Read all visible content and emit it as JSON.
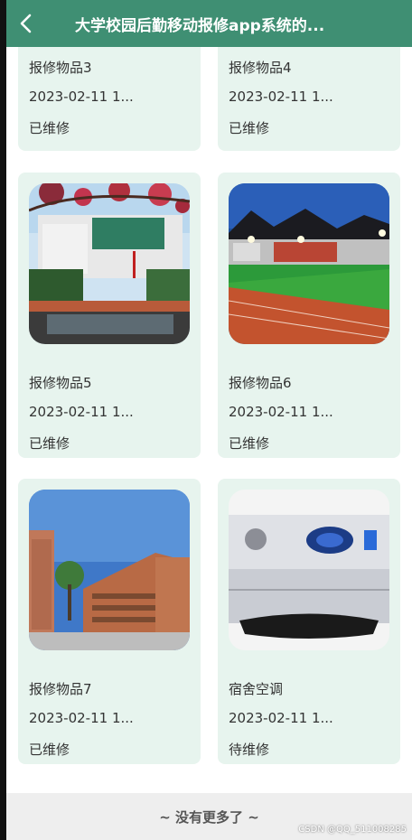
{
  "header": {
    "title": "大学校园后勤移动报修app系统的...",
    "back_icon": "chevron-left-icon",
    "bg_color": "#3f8f73"
  },
  "items": [
    {
      "name": "报修物品3",
      "date": "2023-02-11 1...",
      "status": "已维修"
    },
    {
      "name": "报修物品4",
      "date": "2023-02-11 1...",
      "status": "已维修"
    },
    {
      "name": "报修物品5",
      "date": "2023-02-11 1...",
      "status": "已维修"
    },
    {
      "name": "报修物品6",
      "date": "2023-02-11 1...",
      "status": "已维修"
    },
    {
      "name": "报修物品7",
      "date": "2023-02-11 1...",
      "status": "已维修"
    },
    {
      "name": "宿舍空调",
      "date": "2023-02-11 1...",
      "status": "待维修"
    }
  ],
  "footer": {
    "text": "~ 没有更多了 ~"
  },
  "watermark": "CSDN @QQ_511008285"
}
